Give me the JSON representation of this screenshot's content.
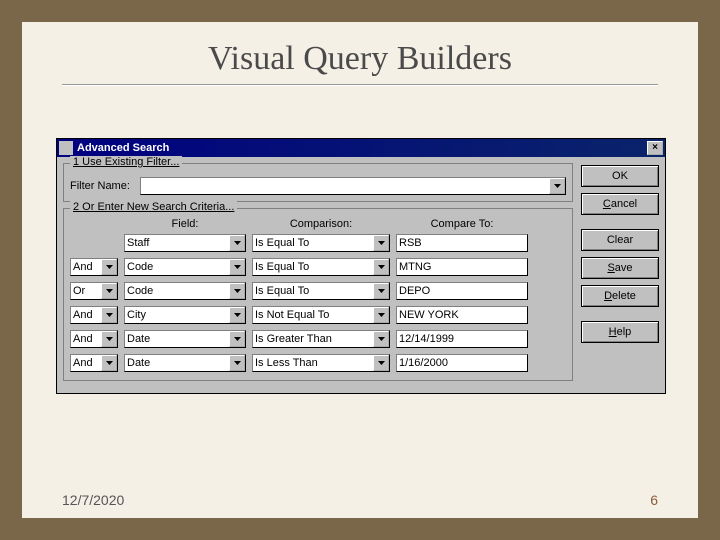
{
  "slide": {
    "title": "Visual Query Builders",
    "date": "12/7/2020",
    "page": "6"
  },
  "dialog": {
    "title": "Advanced Search",
    "group1_legend": "1 Use Existing Filter...",
    "filter_name_label": "Filter Name:",
    "filter_name_value": "",
    "group2_legend": "2 Or Enter New Search Criteria...",
    "headers": {
      "field": "Field:",
      "comparison": "Comparison:",
      "compare_to": "Compare To:"
    },
    "rows": [
      {
        "field": "Staff",
        "comparison": "Is Equal To",
        "value": "RSB"
      },
      {
        "logic": "And",
        "field": "Code",
        "comparison": "Is Equal To",
        "value": "MTNG"
      },
      {
        "logic": "Or",
        "field": "Code",
        "comparison": "Is Equal To",
        "value": "DEPO"
      },
      {
        "logic": "And",
        "field": "City",
        "comparison": "Is Not Equal To",
        "value": "NEW YORK"
      },
      {
        "logic": "And",
        "field": "Date",
        "comparison": "Is Greater Than",
        "value": "12/14/1999"
      },
      {
        "logic": "And",
        "field": "Date",
        "comparison": "Is Less Than",
        "value": "1/16/2000"
      }
    ],
    "buttons": {
      "ok": "OK",
      "cancel": "Cancel",
      "clear": "Clear",
      "save": "Save",
      "delete": "Delete",
      "help": "Help"
    }
  }
}
